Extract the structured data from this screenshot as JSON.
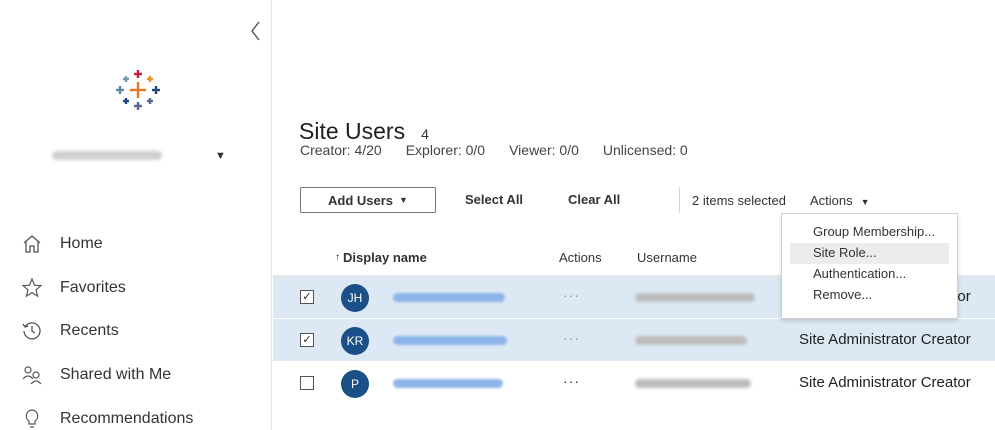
{
  "sidebar": {
    "site_name": "",
    "nav": [
      {
        "label": "Home",
        "icon": "home-icon"
      },
      {
        "label": "Favorites",
        "icon": "star-icon"
      },
      {
        "label": "Recents",
        "icon": "clock-icon"
      },
      {
        "label": "Shared with Me",
        "icon": "shared-users-icon"
      },
      {
        "label": "Recommendations",
        "icon": "lightbulb-icon"
      }
    ]
  },
  "page": {
    "title": "Site Users",
    "count": "4",
    "licenses": [
      "Creator: 4/20",
      "Explorer: 0/0",
      "Viewer: 0/0",
      "Unlicensed: 0"
    ]
  },
  "toolbar": {
    "add_users": "Add Users",
    "select_all": "Select All",
    "clear_all": "Clear All",
    "selected_text": "2 items selected",
    "actions": "Actions"
  },
  "table": {
    "headers": {
      "display_name": "Display name",
      "sort_icon": "↑",
      "actions": "Actions",
      "username": "Username"
    },
    "rows": [
      {
        "checked": "✓",
        "initials": "JH",
        "actions": "···",
        "role": "Site Administrator Creator"
      },
      {
        "checked": "✓",
        "initials": "KR",
        "actions": "···",
        "role": "Site Administrator Creator"
      },
      {
        "checked": "",
        "initials": "P",
        "actions": "···",
        "role": "Site Administrator Creator"
      }
    ]
  },
  "actions_menu": {
    "items": [
      "Group Membership...",
      "Site Role...",
      "Authentication...",
      "Remove..."
    ],
    "visible_role_fragment": "eator"
  },
  "colors": {
    "selection": "#dce9f5",
    "avatar": "#1b4f88",
    "hover": "#ececec"
  }
}
